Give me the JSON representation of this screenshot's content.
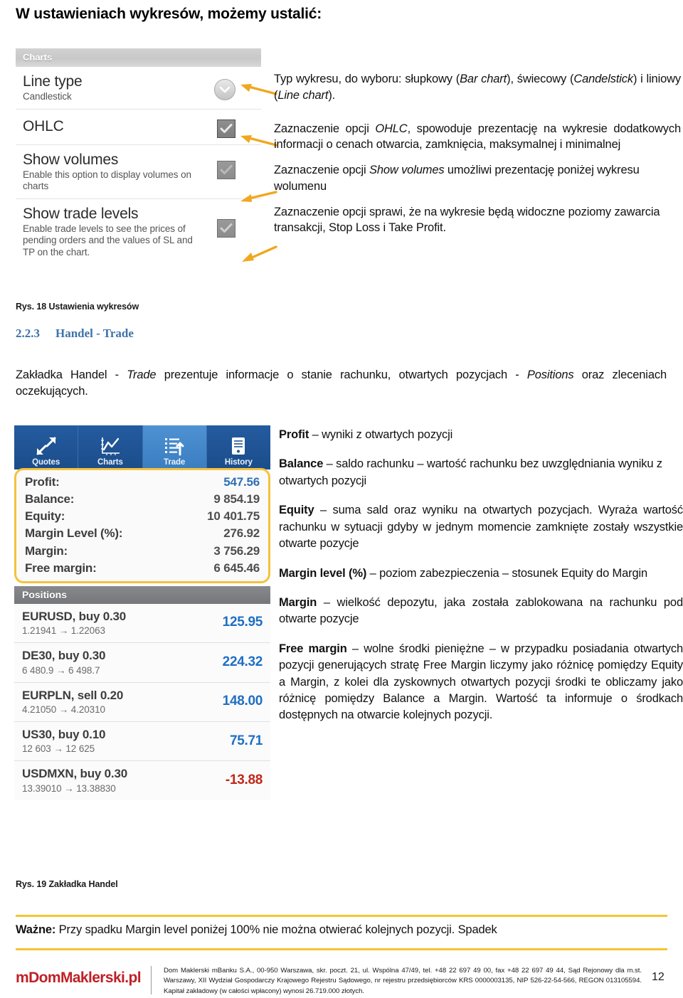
{
  "intro": {
    "heading": "W ustawieniach wykresów, możemy ustalić:"
  },
  "chart_settings": {
    "panel_title": "Charts",
    "rows": [
      {
        "title": "Line type",
        "subtitle": "Candlestick",
        "control": "chevron-down-button"
      },
      {
        "title": "OHLC",
        "subtitle": "",
        "control": "checkbox-checked"
      },
      {
        "title": "Show volumes",
        "subtitle": "Enable this option to display volumes on charts",
        "control": "checkbox-checked"
      },
      {
        "title": "Show trade levels",
        "subtitle": "Enable trade levels to see the prices of pending orders and the values of SL and TP on the chart.",
        "control": "checkbox-checked"
      }
    ],
    "caption": "Rys. 18 Ustawienia wykresów"
  },
  "annotations": [
    {
      "html": "Typ wykresu, do wyboru: słupkowy (<i>Bar chart</i>), świecowy (<i>Candelstick</i>) i liniowy (<i>Line chart</i>)."
    },
    {
      "html": "Zaznaczenie opcji <i>OHLC</i>, spowoduje prezentację na wykresie dodatkowych informacji o cenach otwarcia, zamknięcia, maksymalnej i minimalnej"
    },
    {
      "html": "Zaznaczenie opcji <i>Show volumes</i> umożliwi prezentację poniżej wykresu wolumenu"
    },
    {
      "html": "Zaznaczenie opcji sprawi, że na wykresie będą widoczne poziomy zawarcia transakcji, Stop Loss i Take Profit."
    }
  ],
  "section": {
    "number": "2.2.3",
    "title": "Handel - Trade",
    "paragraph_html": "Zakładka Handel - <i>Trade</i> prezentuje informacje o stanie rachunku, otwartych pozycjach - <i>Positions</i> oraz zleceniach oczekujących."
  },
  "trade_app": {
    "tabs": [
      {
        "label": "Quotes",
        "icon": "quotes-arrows-icon",
        "active": false
      },
      {
        "label": "Charts",
        "icon": "line-chart-icon",
        "active": false
      },
      {
        "label": "Trade",
        "icon": "trade-list-arrow-icon",
        "active": true
      },
      {
        "label": "History",
        "icon": "history-document-icon",
        "active": false
      }
    ],
    "account": [
      {
        "label": "Profit:",
        "value": "547.56",
        "accent": true
      },
      {
        "label": "Balance:",
        "value": "9 854.19",
        "accent": false
      },
      {
        "label": "Equity:",
        "value": "10 401.75",
        "accent": false
      },
      {
        "label": "Margin Level (%):",
        "value": "276.92",
        "accent": false
      },
      {
        "label": "Margin:",
        "value": "3 756.29",
        "accent": false
      },
      {
        "label": "Free margin:",
        "value": "6 645.46",
        "accent": false
      }
    ],
    "positions_header": "Positions",
    "positions": [
      {
        "title": "EURUSD, buy 0.30",
        "prices": "1.21941 → 1.22063",
        "profit": "125.95",
        "negative": false
      },
      {
        "title": "DE30, buy 0.30",
        "prices": "6 480.9 → 6 498.7",
        "profit": "224.32",
        "negative": false
      },
      {
        "title": "EURPLN, sell 0.20",
        "prices": "4.21050 → 4.20310",
        "profit": "148.00",
        "negative": false
      },
      {
        "title": "US30, buy 0.10",
        "prices": "12 603 → 12 625",
        "profit": "75.71",
        "negative": false
      },
      {
        "title": "USDMXN, buy 0.30",
        "prices": "13.39010 → 13.38830",
        "profit": "-13.88",
        "negative": true
      }
    ],
    "caption": "Rys. 19 Zakładka Handel"
  },
  "definitions": [
    {
      "html": "<b>Profit</b> – wyniki z otwartych pozycji",
      "justify": false
    },
    {
      "html": "<b>Balance</b> – saldo rachunku – wartość rachunku bez uwzględniania wyniku z otwartych pozycji",
      "justify": false
    },
    {
      "html": "<b>Equity</b> – suma sald oraz wyniku na otwartych pozycjach. Wyraża wartość rachunku w sytuacji gdyby w jednym momencie zamknięte zostały wszystkie otwarte pozycje",
      "justify": true
    },
    {
      "html": "<b>Margin level (%)</b> – poziom zabezpieczenia – stosunek Equity do Margin",
      "justify": true
    },
    {
      "html": "<b>Margin</b> – wielkość depozytu, jaka została zablokowana na rachunku pod otwarte pozycje",
      "justify": true
    },
    {
      "html": "<b>Free margin</b> – wolne środki pieniężne – w przypadku posiadania otwartych pozycji generujących stratę Free Margin liczymy jako różnicę pomiędzy Equity a Margin, z kolei dla zyskownych otwartych pozycji środki te obliczamy jako różnicę pomiędzy Balance a Margin. Wartość ta informuje o środkach dostępnych na otwarcie kolejnych pozycji.",
      "justify": true
    }
  ],
  "note": {
    "html": "<b>Ważne:</b> Przy spadku Margin level poniżej 100% nie można otwierać kolejnych pozycji. Spadek"
  },
  "footer": {
    "logo": "mDomMaklerski.pl",
    "legal": "Dom Maklerski mBanku S.A., 00-950 Warszawa, skr. poczt. 21, ul. Wspólna 47/49, tel. +48 22 697 49 00, fax +48 22 697 49 44, Sąd Rejonowy dla m.st. Warszawy, XII Wydział Gospodarczy Krajowego Rejestru Sądowego, nr rejestru przedsiębiorców KRS 0000003135, NIP 526-22-54-566, REGON 013105594. Kapitał zakładowy (w całości wpłacony) wynosi 26.719.000 złotych.",
    "page_number": "12"
  },
  "colors": {
    "accent_blue": "#2f6fb5",
    "heading_blue": "#3f72a8",
    "brand_red": "#bf2026",
    "highlight_yellow": "#f5c531",
    "negative_red": "#c02618",
    "tab_blue": "#1f5392",
    "tab_active_blue": "#4e92d4"
  }
}
